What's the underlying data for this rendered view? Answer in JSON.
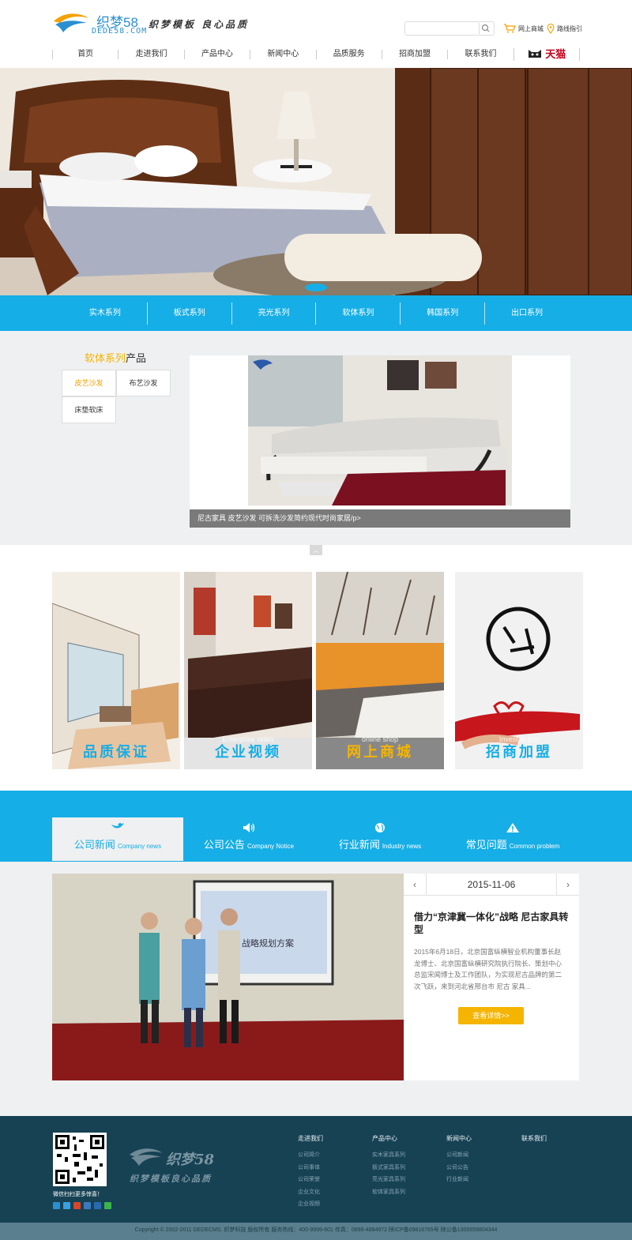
{
  "header": {
    "logo_cn": "织梦58",
    "logo_en": "DEDE58.COM",
    "slogan": "织梦模板 良心品质",
    "search_placeholder": "",
    "shop_link": "网上商城",
    "route_link": "路线指引"
  },
  "nav": {
    "items": [
      "首页",
      "走进我们",
      "产品中心",
      "新闻中心",
      "品质服务",
      "招商加盟",
      "联系我们"
    ],
    "tmall": "天猫"
  },
  "categories": [
    "实木系列",
    "板式系列",
    "亮光系列",
    "软体系列",
    "韩国系列",
    "出口系列"
  ],
  "product": {
    "title_highlight": "软体系列",
    "title_rest": "产品",
    "subcats": [
      "皮艺沙发",
      "布艺沙发",
      "床垫软床"
    ],
    "caption": "尼古家具 皮艺沙发 可拆洗沙发简约现代时尚家居/p>"
  },
  "tiles": [
    {
      "label": "品质保证",
      "sub": "",
      "color": "#16aee6"
    },
    {
      "label": "企业视频",
      "sub": "Enterprise video",
      "color": "#16aee6"
    },
    {
      "label": "网上商城",
      "sub": "online shop",
      "color": "#f5b400"
    },
    {
      "label": "招商加盟",
      "sub": "Invest to join",
      "color": "#16aee6"
    }
  ],
  "news_tabs": [
    {
      "title": "公司新闻",
      "en": "Company news"
    },
    {
      "title": "公司公告",
      "en": "Company Notice"
    },
    {
      "title": "行业新闻",
      "en": "Industry news"
    },
    {
      "title": "常见问题",
      "en": "Common problem"
    }
  ],
  "news": {
    "date": "2015-11-06",
    "headline": "借力“京津冀一体化”战略 尼古家具转型",
    "summary": "2015年6月18日，北京国富纵横智业机构董事长赵龙博士、北京国富纵横研究院执行院长、策划中心总监宋闻博士及工作团队，为实现尼古品牌的第二次飞跃，来到河北省邢台市 尼古 家具...",
    "more": "查看详情>>",
    "screen_text": "战略规划方案"
  },
  "footer": {
    "qr_caption": "微信扫扫更多惊喜！",
    "logo_text": "织梦58",
    "logo_slogan": "织梦模板良心品质",
    "columns": [
      {
        "title": "走进我们",
        "items": [
          "公司简介",
          "公司事体",
          "公司荣誉",
          "企业文化",
          "企业视频"
        ]
      },
      {
        "title": "产品中心",
        "items": [
          "实木家具系列",
          "板式家具系列",
          "亮光家具系列",
          "软体家具系列"
        ]
      },
      {
        "title": "新闻中心",
        "items": [
          "公司新闻",
          "公司公告",
          "行业新闻"
        ]
      },
      {
        "title": "联系我们",
        "items": []
      }
    ],
    "copyright": "Copyright © 2002-2011 DEDECMS. 织梦科技 版权所有     服务热线：400-9999-601     传真：0898-4884972     陕ICP备09816765号     陕公备1305659804344"
  }
}
